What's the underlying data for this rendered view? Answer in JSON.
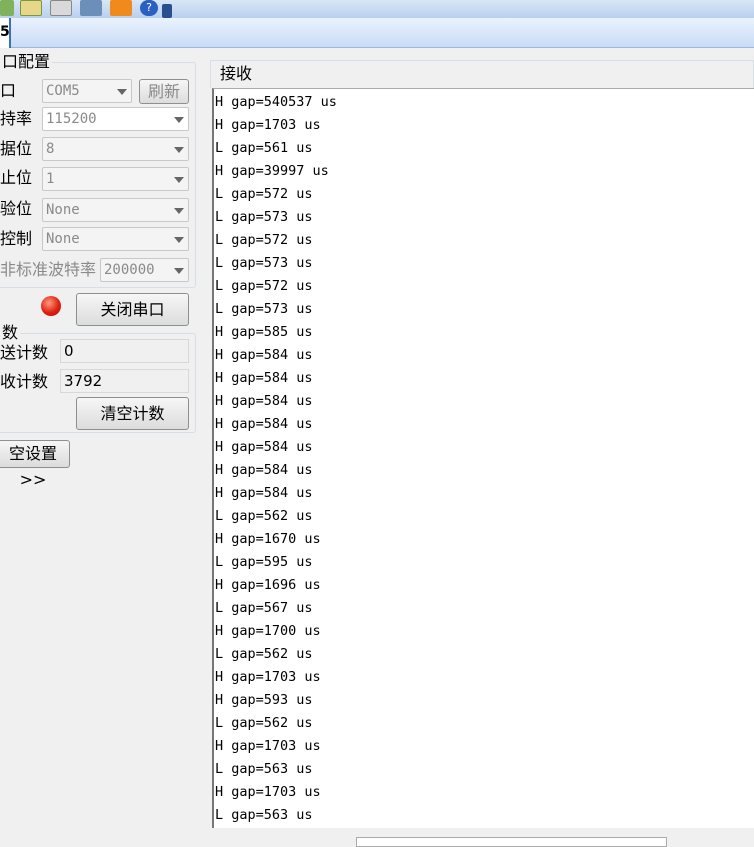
{
  "toolbar": {
    "icons": [
      "list-icon",
      "columns-icon",
      "calculator-icon",
      "computer-icon",
      "upload-icon",
      "help-icon",
      "overflow-icon"
    ]
  },
  "tab": {
    "label": "5"
  },
  "port_config": {
    "title": "口配置",
    "port_label": "口",
    "port_value": "COM5",
    "refresh": "刷新",
    "baud_label": "持率",
    "baud_value": "115200",
    "data_label": "据位",
    "data_value": "8",
    "stop_label": "止位",
    "stop_value": "1",
    "parity_label": "验位",
    "parity_value": "None",
    "flow_label": "控制",
    "flow_value": "None",
    "nonstd_label": "非标准波特率",
    "nonstd_value": "200000",
    "close_port": "关闭串口",
    "status_color": "#e02010"
  },
  "count": {
    "title": "数",
    "send_label": "送计数",
    "send_value": "0",
    "recv_label": "收计数",
    "recv_value": "3792",
    "clear": "清空计数"
  },
  "more_settings": "空设置>>",
  "receive": {
    "title": "接收",
    "lines": [
      "H gap=540537 us",
      "H gap=1703 us",
      "L gap=561 us",
      "H gap=39997 us",
      "L gap=572 us",
      "L gap=573 us",
      "L gap=572 us",
      "L gap=573 us",
      "L gap=572 us",
      "L gap=573 us",
      "H gap=585 us",
      "H gap=584 us",
      "H gap=584 us",
      "H gap=584 us",
      "H gap=584 us",
      "H gap=584 us",
      "H gap=584 us",
      "H gap=584 us",
      "L gap=562 us",
      "H gap=1670 us",
      "L gap=595 us",
      "H gap=1696 us",
      "L gap=567 us",
      "H gap=1700 us",
      "L gap=562 us",
      "H gap=1703 us",
      "H gap=593 us",
      "L gap=562 us",
      "H gap=1703 us",
      "L gap=563 us",
      "H gap=1703 us",
      "L gap=563 us"
    ]
  }
}
